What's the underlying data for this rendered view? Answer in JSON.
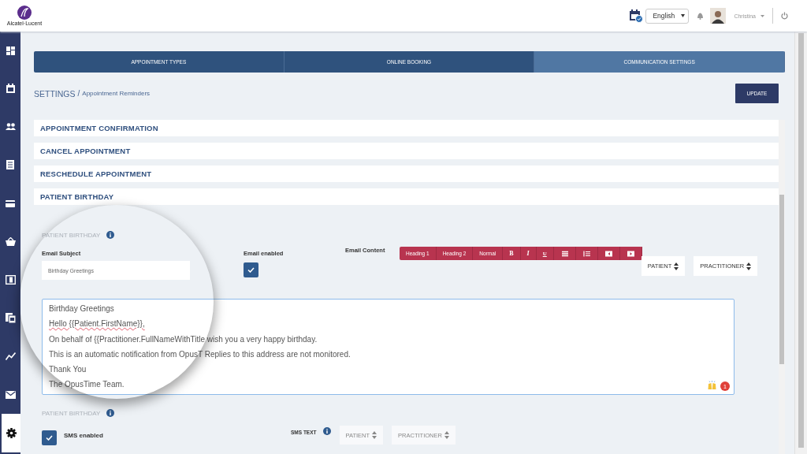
{
  "header": {
    "logo_text": "Alcatel·Lucent",
    "language": "English",
    "user": "Christina"
  },
  "sidebar": {
    "items": [
      {
        "kind": "dashboard",
        "selected": false
      },
      {
        "kind": "calendar",
        "selected": false
      },
      {
        "kind": "people",
        "selected": false
      },
      {
        "kind": "document",
        "selected": false
      },
      {
        "kind": "card",
        "selected": false
      },
      {
        "kind": "basket",
        "selected": false
      },
      {
        "kind": "invoice",
        "selected": false
      },
      {
        "kind": "statement",
        "selected": false
      },
      {
        "kind": "chart",
        "selected": false
      },
      {
        "kind": "mail",
        "selected": false
      },
      {
        "kind": "settings",
        "selected": true
      }
    ]
  },
  "tabs": [
    {
      "label": "APPOINTMENT TYPES",
      "selected": false
    },
    {
      "label": "ONLINE BOOKING",
      "selected": false
    },
    {
      "label": "COMMUNICATION SETTINGS",
      "selected": true
    }
  ],
  "breadcrumb": {
    "root": "SETTINGS",
    "separator": "/",
    "page": "Appointment Reminders"
  },
  "update_button": "UPDATE",
  "sections": [
    "APPOINTMENT CONFIRMATION",
    "CANCEL APPOINTMENT",
    "RESCHEDULE APPOINTMENT",
    "PATIENT BIRTHDAY"
  ],
  "email_panel": {
    "heading": "PATIENT BIRTHDAY",
    "subject_label": "Email Subject",
    "subject_value": "Birthday Greetings",
    "enabled_label": "Email enabled",
    "enabled_checked": true,
    "content_label": "Email Content",
    "toolbar": [
      {
        "kind": "text",
        "label": "Heading 1"
      },
      {
        "kind": "text",
        "label": "Heading 2"
      },
      {
        "kind": "text",
        "label": "Normal"
      },
      {
        "kind": "bold",
        "label": "B"
      },
      {
        "kind": "italic",
        "label": "I"
      },
      {
        "kind": "underline",
        "label": "U"
      },
      {
        "kind": "bullets"
      },
      {
        "kind": "numbers"
      },
      {
        "kind": "outdent"
      },
      {
        "kind": "indent"
      }
    ],
    "placeholders": [
      "PATIENT",
      "PRACTITIONER"
    ],
    "body_lines": [
      {
        "text": "Birthday Greetings"
      },
      {
        "text": "Hello {{Patient.FirstName}},",
        "spell_error": true
      },
      {
        "text": "On behalf of {{Practitioner.FullNameWithTitle",
        "rest": "wish you a very happy birthday."
      },
      {
        "text": "This is an automatic notification from OpusT",
        "rest": "Replies to this address are not monitored."
      },
      {
        "text": "Thank You"
      },
      {
        "text": "The OpusTime Team."
      }
    ],
    "badge": "1"
  },
  "sms_panel": {
    "heading": "PATIENT BIRTHDAY",
    "enabled_label": "SMS enabled",
    "enabled_checked": true,
    "text_label": "SMS TEXT",
    "placeholders": [
      "PATIENT",
      "PRACTITIONER"
    ]
  }
}
